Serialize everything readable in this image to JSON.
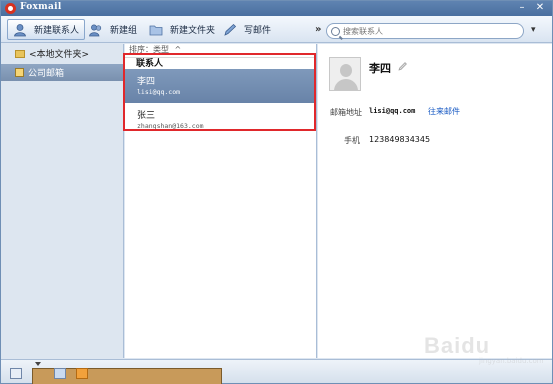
{
  "window": {
    "title": "Foxmail",
    "minimize_glyph": "–",
    "close_glyph": "✕"
  },
  "toolbar": {
    "new_contact": "新建联系人",
    "new_group": "新建组",
    "new_folder": "新建文件夹",
    "write_mail": "写邮件",
    "overflow": "»",
    "search_placeholder": "搜索联系人",
    "dropdown": "▾"
  },
  "folders": [
    {
      "label": "<本地文件夹>",
      "icon": "folder-icon"
    },
    {
      "label": "公司邮箱",
      "icon": "mailbox-icon",
      "selected": true
    }
  ],
  "list": {
    "sort_label": "排序：类型",
    "sort_arrow": "^",
    "group_header": "联系人",
    "contacts": [
      {
        "name": "李四",
        "email": "lisi@qq.com",
        "selected": true
      },
      {
        "name": "张三",
        "email": "zhangshan@163.com",
        "selected": false
      }
    ]
  },
  "detail": {
    "name": "李四",
    "email_label": "邮箱地址",
    "email": "lisi@qq.com",
    "history_link": "往来邮件",
    "phone_label": "手机",
    "phone": "123849834345"
  },
  "watermark": {
    "brand": "Baidu",
    "sub": "jingyan.baidu.com"
  },
  "colors": {
    "accent": "#4a6f9f",
    "selection": "#7690b2",
    "highlight_box": "#e0282c",
    "link": "#1a5bc4"
  }
}
